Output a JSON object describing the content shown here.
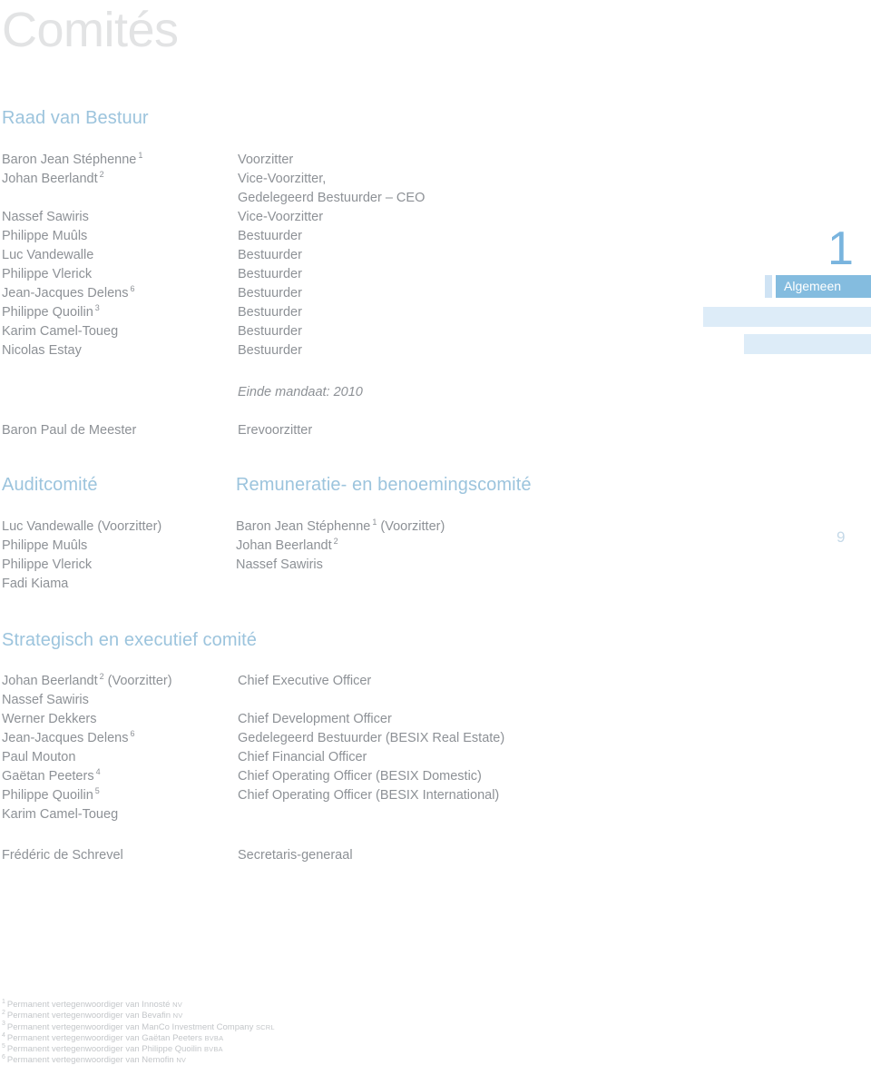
{
  "page": {
    "title": "Comités",
    "page_number": "9"
  },
  "chapter_tab": {
    "number": "1",
    "active_label": "Algemeen"
  },
  "board": {
    "heading": "Raad van Bestuur",
    "members": [
      {
        "name": "Baron Jean Stéphenne",
        "sup": "1",
        "role": "Voorzitter",
        "role2": ""
      },
      {
        "name": "Johan Beerlandt",
        "sup": "2",
        "role": "Vice-Voorzitter,",
        "role2": "Gedelegeerd Bestuurder – CEO"
      },
      {
        "name": "Nassef Sawiris",
        "sup": "",
        "role": "Vice-Voorzitter",
        "role2": ""
      },
      {
        "name": "Philippe Muûls",
        "sup": "",
        "role": "Bestuurder",
        "role2": ""
      },
      {
        "name": "Luc Vandewalle",
        "sup": "",
        "role": "Bestuurder",
        "role2": ""
      },
      {
        "name": "Philippe Vlerick",
        "sup": "",
        "role": "Bestuurder",
        "role2": ""
      },
      {
        "name": "Jean-Jacques Delens",
        "sup": "6",
        "role": "Bestuurder",
        "role2": ""
      },
      {
        "name": "Philippe Quoilin",
        "sup": "3",
        "role": "Bestuurder",
        "role2": ""
      },
      {
        "name": "Karim Camel-Toueg",
        "sup": "",
        "role": "Bestuurder",
        "role2": ""
      },
      {
        "name": "Nicolas Estay",
        "sup": "",
        "role": "Bestuurder",
        "role2": ""
      }
    ],
    "mandate_note": "Einde mandaat: 2010",
    "honorary": {
      "name": "Baron Paul de Meester",
      "role": "Erevoorzitter"
    }
  },
  "audit_committee": {
    "heading": "Auditcomité",
    "members": [
      {
        "name": "Luc Vandewalle (Voorzitter)",
        "sup": ""
      },
      {
        "name": "Philippe Muûls",
        "sup": ""
      },
      {
        "name": "Philippe Vlerick",
        "sup": ""
      },
      {
        "name": "Fadi Kiama",
        "sup": ""
      }
    ]
  },
  "remuneration_committee": {
    "heading": "Remuneratie- en benoemingscomité",
    "members": [
      {
        "name_pre": "Baron Jean Stéphenne",
        "sup": "1",
        "name_post": " (Voorzitter)"
      },
      {
        "name_pre": "Johan Beerlandt",
        "sup": "2",
        "name_post": ""
      },
      {
        "name_pre": "Nassef Sawiris",
        "sup": "",
        "name_post": ""
      }
    ]
  },
  "strategic_committee": {
    "heading": "Strategisch en executief comité",
    "members": [
      {
        "name_pre": "Johan Beerlandt",
        "sup": "2",
        "name_post": " (Voorzitter)",
        "role": "Chief Executive Officer"
      },
      {
        "name_pre": "Nassef Sawiris",
        "sup": "",
        "name_post": "",
        "role": ""
      },
      {
        "name_pre": "Werner Dekkers",
        "sup": "",
        "name_post": "",
        "role": "Chief Development Officer"
      },
      {
        "name_pre": "Jean-Jacques Delens",
        "sup": "6",
        "name_post": "",
        "role": "Gedelegeerd Bestuurder (BESIX Real Estate)"
      },
      {
        "name_pre": "Paul Mouton",
        "sup": "",
        "name_post": "",
        "role": "Chief Financial Officer"
      },
      {
        "name_pre": "Gaëtan Peeters",
        "sup": "4",
        "name_post": "",
        "role": "Chief Operating Officer (BESIX Domestic)"
      },
      {
        "name_pre": "Philippe Quoilin",
        "sup": "5",
        "name_post": "",
        "role": "Chief Operating Officer (BESIX International)"
      },
      {
        "name_pre": "Karim Camel-Toueg",
        "sup": "",
        "name_post": "",
        "role": ""
      }
    ],
    "secretary": {
      "name": "Frédéric de Schrevel",
      "role": "Secretaris-generaal"
    }
  },
  "footnotes": [
    {
      "marker": "1",
      "text": "Permanent vertegenwoordiger van Innosté ",
      "suffix": "NV"
    },
    {
      "marker": "2",
      "text": "Permanent vertegenwoordiger van Bevafin ",
      "suffix": "NV"
    },
    {
      "marker": "3",
      "text": "Permanent vertegenwoordiger van ManCo Investment Company ",
      "suffix": "SCRL"
    },
    {
      "marker": "4",
      "text": "Permanent vertegenwoordiger van Gaëtan Peeters ",
      "suffix": "BVBA"
    },
    {
      "marker": "5",
      "text": "Permanent vertegenwoordiger van Philippe Quoilin ",
      "suffix": "BVBA"
    },
    {
      "marker": "6",
      "text": "Permanent vertegenwoordiger van Nemofin ",
      "suffix": "NV"
    }
  ],
  "colors": {
    "heading_blue": "#9cc4dd",
    "tab_active_blue": "#84bcdf",
    "tab_light_blue": "#ddecf8",
    "body_gray": "#8d9196",
    "title_gray": "#e2e3e4"
  }
}
